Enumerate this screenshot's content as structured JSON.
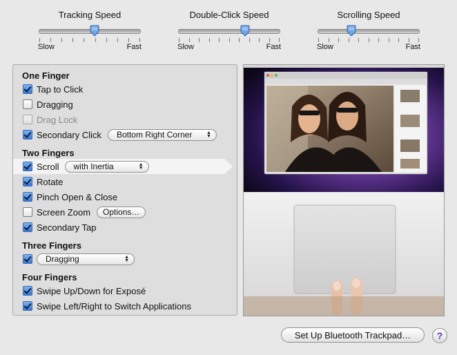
{
  "sliders": [
    {
      "title": "Tracking Speed",
      "min_label": "Slow",
      "max_label": "Fast",
      "value": 0.55
    },
    {
      "title": "Double-Click Speed",
      "min_label": "Slow",
      "max_label": "Fast",
      "value": 0.66
    },
    {
      "title": "Scrolling Speed",
      "min_label": "Slow",
      "max_label": "Fast",
      "value": 0.33
    }
  ],
  "one_finger": {
    "title": "One Finger",
    "tap_to_click": {
      "label": "Tap to Click",
      "checked": true
    },
    "dragging": {
      "label": "Dragging",
      "checked": false
    },
    "drag_lock": {
      "label": "Drag Lock",
      "checked": false,
      "disabled": true
    },
    "secondary_click": {
      "label": "Secondary Click",
      "checked": true,
      "option": "Bottom Right Corner"
    }
  },
  "two_fingers": {
    "title": "Two Fingers",
    "scroll": {
      "label": "Scroll",
      "checked": true,
      "option": "with Inertia"
    },
    "rotate": {
      "label": "Rotate",
      "checked": true
    },
    "pinch": {
      "label": "Pinch Open & Close",
      "checked": true
    },
    "screen_zoom": {
      "label": "Screen Zoom",
      "checked": false,
      "options_label": "Options…"
    },
    "secondary_tap": {
      "label": "Secondary Tap",
      "checked": true
    }
  },
  "three_fingers": {
    "title": "Three Fingers",
    "dragging": {
      "checked": true,
      "option": "Dragging"
    }
  },
  "four_fingers": {
    "title": "Four Fingers",
    "swipe_updown": {
      "label": "Swipe Up/Down for Exposé",
      "checked": true
    },
    "swipe_leftright": {
      "label": "Swipe Left/Right to Switch Applications",
      "checked": true
    }
  },
  "footer": {
    "bluetooth_label": "Set Up Bluetooth Trackpad…",
    "help_label": "?"
  },
  "colors": {
    "accent": "#3a78d3",
    "help": "#5b39b8"
  }
}
